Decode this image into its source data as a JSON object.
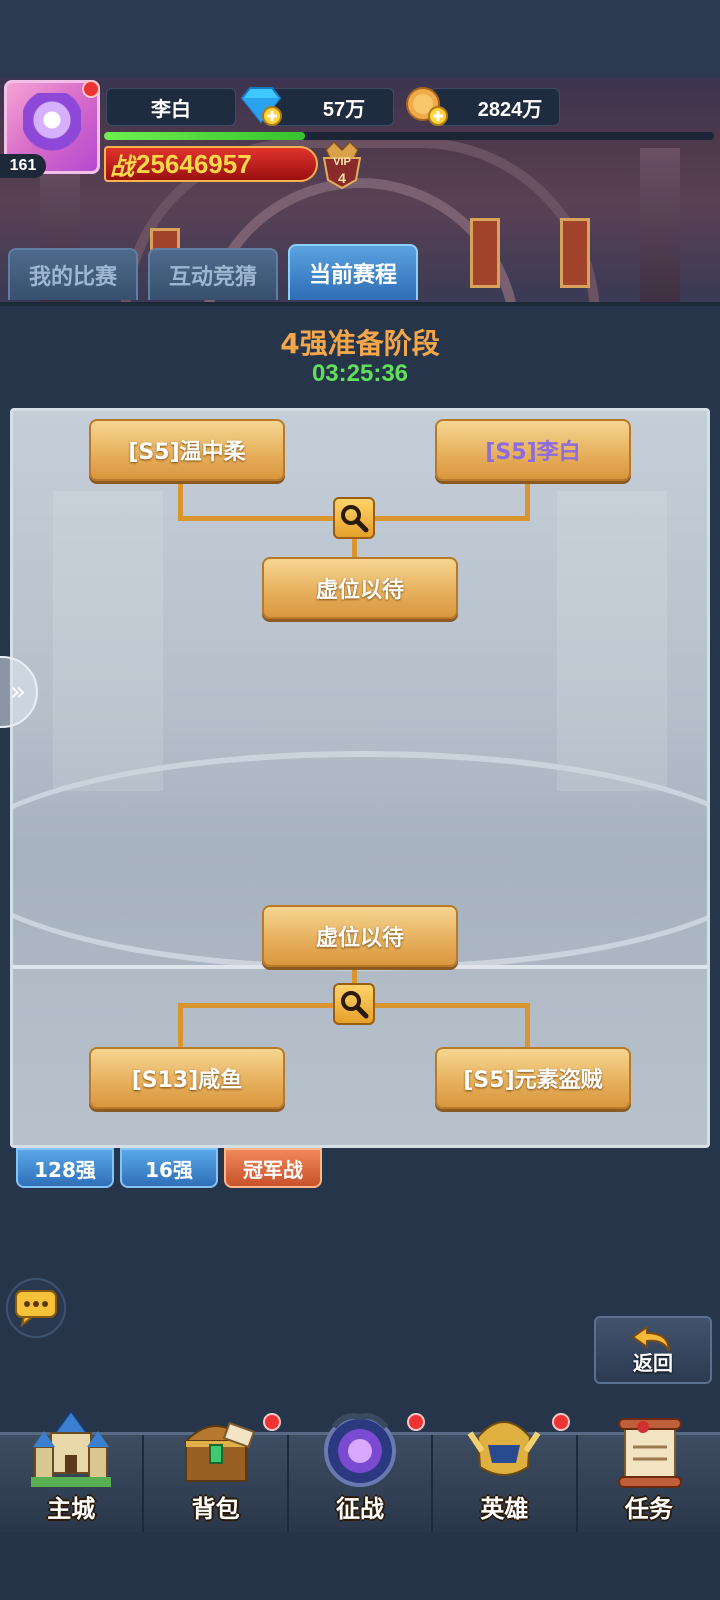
{
  "player": {
    "name": "李白",
    "level": "161",
    "diamonds": "57万",
    "gold": "2824万",
    "power_prefix": "战",
    "power_value": "25646957",
    "vip_label": "VIP",
    "vip_level": "4",
    "xp_fraction": 0.33
  },
  "tabs": [
    {
      "label": "我的比赛",
      "active": false
    },
    {
      "label": "互动竞猜",
      "active": false
    },
    {
      "label": "当前赛程",
      "active": true
    }
  ],
  "stage": {
    "title": "4强准备阶段",
    "countdown": "03:25:36"
  },
  "bracket": {
    "top": {
      "left": "[S5]温中柔",
      "right": "[S5]李白",
      "winner": "虚位以待"
    },
    "bottom": {
      "winner": "虚位以待",
      "left": "[S13]咸鱼",
      "right": "[S5]元素盗贼"
    }
  },
  "rounds": [
    {
      "label": "128强"
    },
    {
      "label": "16强"
    },
    {
      "label": "冠军战"
    }
  ],
  "back_label": "返回",
  "nav": [
    {
      "label": "主城",
      "icon": "castle-icon",
      "badge": false
    },
    {
      "label": "背包",
      "icon": "treasure-chest-icon",
      "badge": true
    },
    {
      "label": "征战",
      "icon": "portal-dragon-icon",
      "badge": true
    },
    {
      "label": "英雄",
      "icon": "hero-helmet-icon",
      "badge": true
    },
    {
      "label": "任务",
      "icon": "scroll-icon",
      "badge": false
    }
  ],
  "colors": {
    "stage_title": "#f4a648",
    "countdown": "#5ee05a",
    "self_name": "#8a6ce0"
  }
}
